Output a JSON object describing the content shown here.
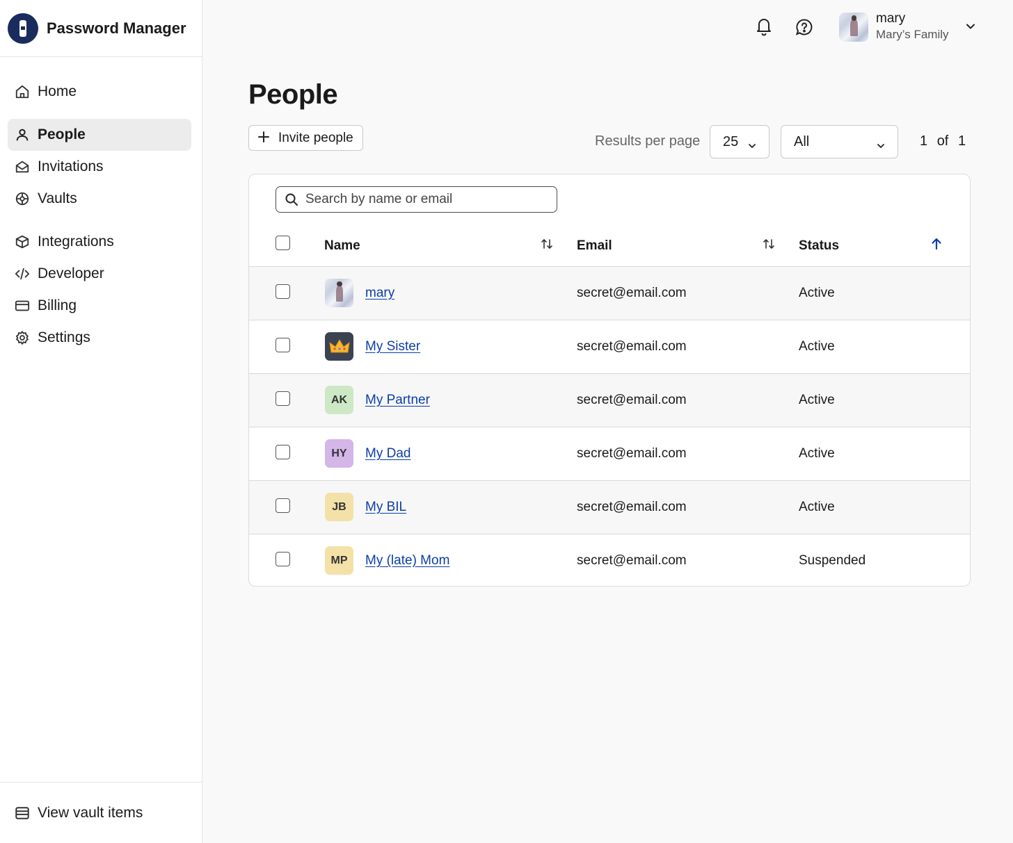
{
  "app": {
    "name": "Password Manager"
  },
  "sidebar": {
    "items": [
      {
        "label": "Home",
        "icon": "home-icon"
      },
      {
        "label": "People",
        "icon": "person-icon",
        "active": true
      },
      {
        "label": "Invitations",
        "icon": "envelope-open-icon"
      },
      {
        "label": "Vaults",
        "icon": "vault-icon"
      },
      {
        "label": "Integrations",
        "icon": "box-icon"
      },
      {
        "label": "Developer",
        "icon": "code-icon"
      },
      {
        "label": "Billing",
        "icon": "credit-card-icon"
      },
      {
        "label": "Settings",
        "icon": "gear-icon"
      }
    ],
    "footer": {
      "label": "View vault items",
      "icon": "vault-items-icon"
    }
  },
  "header": {
    "user": {
      "name": "mary",
      "account": "Mary’s Family"
    }
  },
  "main": {
    "title": "People",
    "invite_label": "Invite people",
    "results_per_page_label": "Results per page",
    "per_page": "25",
    "filter": "All",
    "pager": {
      "current": "1",
      "of": "of",
      "total": "1"
    },
    "search_placeholder": "Search by name or email",
    "columns": {
      "name": "Name",
      "email": "Email",
      "status": "Status"
    },
    "rows": [
      {
        "name": "mary",
        "avatar": "photo",
        "email": "secret@email.com",
        "status": "Active"
      },
      {
        "name": "My Sister",
        "avatar": "crown",
        "email": "secret@email.com",
        "status": "Active"
      },
      {
        "name": "My Partner",
        "avatar": "AK",
        "avatar_color": "#cde8c4",
        "email": "secret@email.com",
        "status": "Active"
      },
      {
        "name": "My Dad",
        "avatar": "HY",
        "avatar_color": "#d4b6e8",
        "email": "secret@email.com",
        "status": "Active"
      },
      {
        "name": "My BIL",
        "avatar": "JB",
        "avatar_color": "#f4e1a8",
        "email": "secret@email.com",
        "status": "Active"
      },
      {
        "name": "My (late) Mom",
        "avatar": "MP",
        "avatar_color": "#f4e1a8",
        "email": "secret@email.com",
        "status": "Suspended"
      }
    ]
  },
  "colors": {
    "link": "#0b3ea8",
    "brand": "#1a2b5e",
    "sort_active": "#0b3ea8"
  }
}
